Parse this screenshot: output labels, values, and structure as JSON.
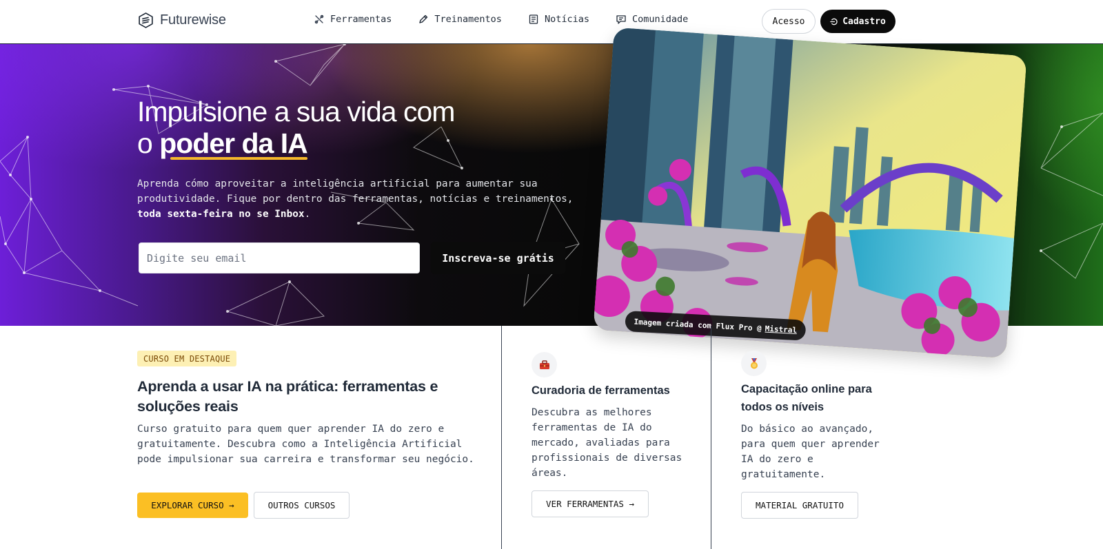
{
  "header": {
    "logo_text": "Futurewise",
    "nav": [
      {
        "label": "Ferramentas",
        "icon": "tools-icon"
      },
      {
        "label": "Treinamentos",
        "icon": "pencil-icon"
      },
      {
        "label": "Notícias",
        "icon": "newspaper-icon"
      },
      {
        "label": "Comunidade",
        "icon": "chat-icon"
      }
    ],
    "login_label": "Acesso",
    "signup_label": "Cadastro"
  },
  "hero": {
    "title_line1": "Impulsione a sua vida com",
    "title_prefix": "o",
    "title_highlight": "poder da IA",
    "description": "Aprenda cómo aproveitar a inteligência artificial para aumentar sua produtividade. Fique por dentro das ferramentas, notícias e treinamentos,",
    "description_bold": "toda sexta-feira no se Inbox",
    "description_end": ".",
    "email_placeholder": "Digite seu email",
    "subscribe_label": "Inscreva-se grátis",
    "image_caption": "Imagem criada com Flux Pro @",
    "image_caption_link": "Mistral"
  },
  "featured_course": {
    "badge": "CURSO EM DESTAQUE",
    "title": "Aprenda a usar IA na prática: ferramentas e soluções reais",
    "description": "Curso gratuito para quem quer aprender IA do zero e gratuitamente. Descubra como a Inteligência Artificial pode impulsionar sua carreira e transformar seu negócio.",
    "explore_label": "EXPLORAR CURSO →",
    "other_label": "OUTROS CURSOS"
  },
  "features": [
    {
      "icon": "toolbox-icon",
      "title": "Curadoria de ferramentas",
      "description": "Descubra as melhores ferramentas de IA do mercado, avaliadas para profissionais de diversas áreas.",
      "button_label": "VER FERRAMENTAS →"
    },
    {
      "icon": "medal-icon",
      "title": "Capacitação online para todos os níveis",
      "description": "Do básico ao avançado, para quem quer aprender IA do zero e gratuitamente.",
      "button_label": "MATERIAL GRATUITO"
    }
  ],
  "colors": {
    "accent": "#fbbf24",
    "dark": "#0b0b0b",
    "badge_bg": "#fdf0b4"
  }
}
